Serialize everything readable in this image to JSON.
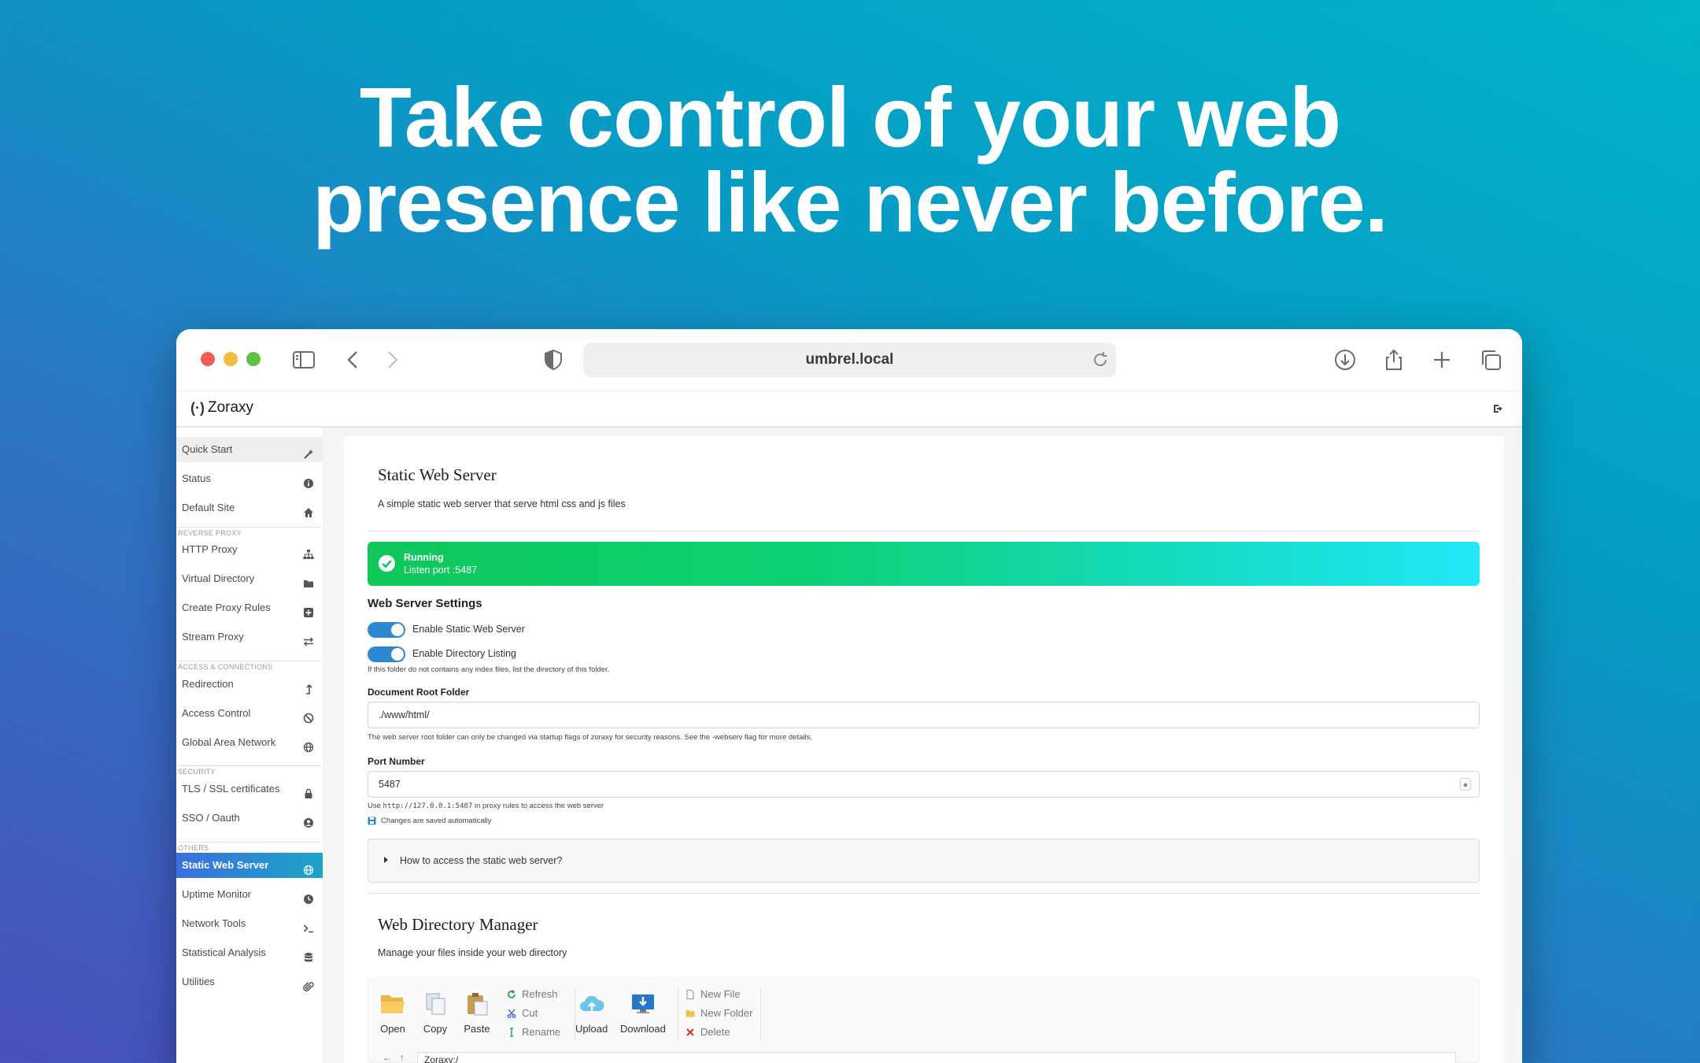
{
  "headline": {
    "line1": "Take control of your web",
    "line2": "presence like never before."
  },
  "browser": {
    "url": "umbrel.local"
  },
  "app": {
    "name": "Zoraxy",
    "logo_mark": "(·)"
  },
  "sidebar": {
    "items": [
      {
        "label": "Quick Start",
        "icon": "wand-icon"
      },
      {
        "label": "Status",
        "icon": "info-icon"
      },
      {
        "label": "Default Site",
        "icon": "home-icon"
      },
      {
        "label": "HTTP Proxy",
        "icon": "sitemap-icon"
      },
      {
        "label": "Virtual Directory",
        "icon": "folder-icon"
      },
      {
        "label": "Create Proxy Rules",
        "icon": "plus-square-icon"
      },
      {
        "label": "Stream Proxy",
        "icon": "exchange-icon"
      },
      {
        "label": "Redirection",
        "icon": "level-up-icon"
      },
      {
        "label": "Access Control",
        "icon": "ban-icon"
      },
      {
        "label": "Global Area Network",
        "icon": "globe-icon"
      },
      {
        "label": "TLS / SSL certificates",
        "icon": "lock-icon"
      },
      {
        "label": "SSO / Oauth",
        "icon": "user-circle-icon"
      },
      {
        "label": "Static Web Server",
        "icon": "globe-icon"
      },
      {
        "label": "Uptime Monitor",
        "icon": "clock-icon"
      },
      {
        "label": "Network Tools",
        "icon": "terminal-icon"
      },
      {
        "label": "Statistical Analysis",
        "icon": "database-icon"
      },
      {
        "label": "Utilities",
        "icon": "paperclip-icon"
      }
    ],
    "sections": [
      "REVERSE PROXY",
      "ACCESS & CONNECTIONS",
      "SECURITY",
      "OTHERS"
    ]
  },
  "static_server": {
    "title": "Static Web Server",
    "description": "A simple static web server that serve html css and js files",
    "status_title": "Running",
    "status_port": "Listen port :5487",
    "settings_title": "Web Server Settings",
    "toggle_enable_label": "Enable Static Web Server",
    "toggle_enable_on": true,
    "toggle_listing_label": "Enable Directory Listing",
    "toggle_listing_on": true,
    "listing_hint": "If this folder do not contains any index files, list the directory of this folder.",
    "root_label": "Document Root Folder",
    "root_value": "./www/html/",
    "root_hint": "The web server root folder can only be changed via startup flags of zoraxy for security reasons. See the -webserv flag for more details.",
    "port_label": "Port Number",
    "port_value": "5487",
    "port_hint_prefix": "Use ",
    "port_hint_code": "http://127.0.0.1:5487",
    "port_hint_suffix": " in proxy rules to access the web server",
    "autosave": "Changes are saved automatically",
    "accordion": "How to access the static web server?"
  },
  "dir_manager": {
    "title": "Web Directory Manager",
    "description": "Manage your files inside your web directory",
    "buttons": {
      "open": "Open",
      "copy": "Copy",
      "paste": "Paste",
      "refresh": "Refresh",
      "cut": "Cut",
      "rename": "Rename",
      "upload": "Upload",
      "download": "Download",
      "new_file": "New File",
      "new_folder": "New Folder",
      "delete": "Delete"
    },
    "path": "Zoraxy:/"
  },
  "colors": {
    "accent": "#2d88d2",
    "status_start": "#0fc85a",
    "status_end": "#23e6f8",
    "active_start": "#3b6fe0",
    "active_end": "#1ca4c5"
  }
}
